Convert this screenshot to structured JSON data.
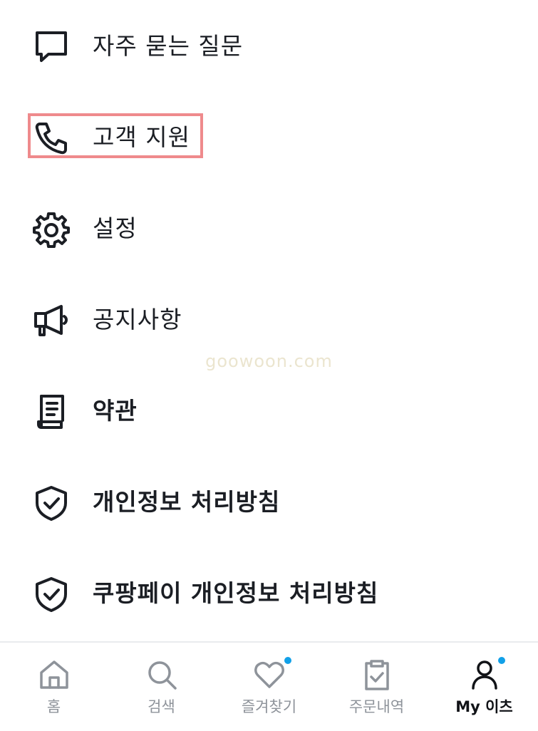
{
  "menu": {
    "items": [
      {
        "label": "자주 묻는 질문",
        "icon": "chat-bubble-icon"
      },
      {
        "label": "고객 지원",
        "icon": "phone-icon"
      },
      {
        "label": "설정",
        "icon": "gear-icon"
      },
      {
        "label": "공지사항",
        "icon": "megaphone-icon"
      },
      {
        "label": "약관",
        "icon": "document-icon"
      },
      {
        "label": "개인정보 처리방침",
        "icon": "shield-check-icon"
      },
      {
        "label": "쿠팡페이 개인정보 처리방침",
        "icon": "shield-check-icon"
      }
    ],
    "highlighted_item": "고객 지원",
    "highlight_color": "#ef8a8c"
  },
  "watermark": "goowoon.com",
  "tabbar": {
    "tabs": [
      {
        "label": "홈",
        "icon": "home-icon",
        "active": false,
        "badge": false
      },
      {
        "label": "검색",
        "icon": "search-icon",
        "active": false,
        "badge": false
      },
      {
        "label": "즐겨찾기",
        "icon": "heart-icon",
        "active": false,
        "badge": true
      },
      {
        "label": "주문내역",
        "icon": "clipboard-check-icon",
        "active": false,
        "badge": false
      },
      {
        "label": "My 이츠",
        "icon": "person-icon",
        "active": true,
        "badge": true
      }
    ],
    "badge_color": "#11a0e8",
    "active_color": "#111317",
    "inactive_color": "#8e939a"
  }
}
